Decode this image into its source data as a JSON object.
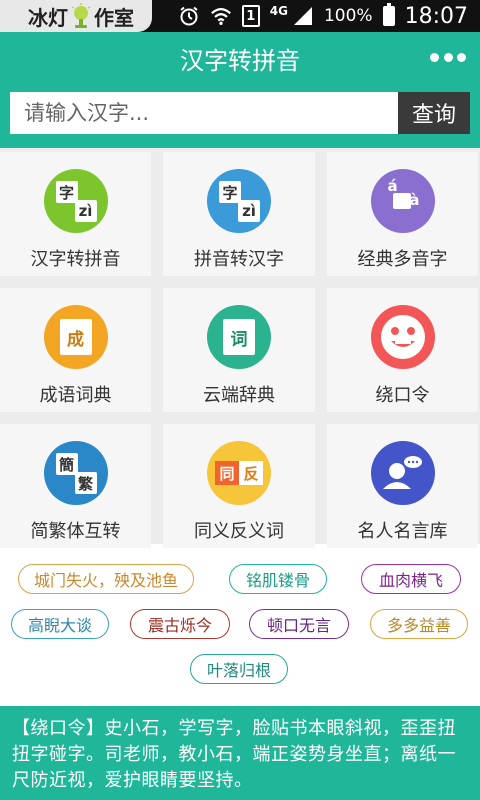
{
  "status_bar": {
    "brand_left": "冰灯",
    "brand_right": "作室",
    "network": "4G",
    "sim": "1",
    "battery": "100%",
    "time": "18:07"
  },
  "header": {
    "title": "汉字转拼音",
    "more_icon": "more-dots-icon"
  },
  "search": {
    "placeholder": "请输入汉字...",
    "button_label": "查询"
  },
  "tiles": [
    {
      "label": "汉字转拼音",
      "icon": "hanzi-to-pinyin-icon",
      "color": "#7cc52d",
      "g1": "字",
      "g2": "zì"
    },
    {
      "label": "拼音转汉字",
      "icon": "pinyin-to-hanzi-icon",
      "color": "#3b9ad8",
      "g1": "字",
      "g2": "zì"
    },
    {
      "label": "经典多音字",
      "icon": "polyphonic-icon",
      "color": "#8b6fd0",
      "g1": "á",
      "g2": "à"
    },
    {
      "label": "成语词典",
      "icon": "idiom-book-icon",
      "color": "#f3a623",
      "g1": "成",
      "g2": ""
    },
    {
      "label": "云端辞典",
      "icon": "cloud-dictionary-icon",
      "color": "#2bb28e",
      "g1": "词",
      "g2": ""
    },
    {
      "label": "绕口令",
      "icon": "smiley-face-icon",
      "color": "#f25656",
      "g1": "",
      "g2": ""
    },
    {
      "label": "简繁体互转",
      "icon": "simplified-traditional-icon",
      "color": "#2a87c8",
      "g1": "簡",
      "g2": "繁"
    },
    {
      "label": "同义反义词",
      "icon": "synonym-antonym-icon",
      "color": "#f6c53a",
      "g1": "同",
      "g2": "反"
    },
    {
      "label": "名人名言库",
      "icon": "famous-quote-icon",
      "color": "#4355c9",
      "g1": "",
      "g2": ""
    }
  ],
  "tags": [
    {
      "text": "城门失火，殃及池鱼",
      "color": "#e0a14a"
    },
    {
      "text": "铭肌镂骨",
      "color": "#1fb69a"
    },
    {
      "text": "血肉横飞",
      "color": "#9a2fa8"
    },
    {
      "text": "高睨大谈",
      "color": "#3aa0c4"
    },
    {
      "text": "震古烁今",
      "color": "#b0372e"
    },
    {
      "text": "顿口无言",
      "color": "#7a2f9a"
    },
    {
      "text": "多多益善",
      "color": "#d9a640"
    },
    {
      "text": "叶落归根",
      "color": "#2aa59a"
    }
  ],
  "tongue_twister": "【绕口令】史小石，学写字，脸贴书本眼斜视，歪歪扭扭字碰字。司老师，教小石，端正姿势身坐直；离纸一尺防近视，爱护眼睛要坚持。"
}
